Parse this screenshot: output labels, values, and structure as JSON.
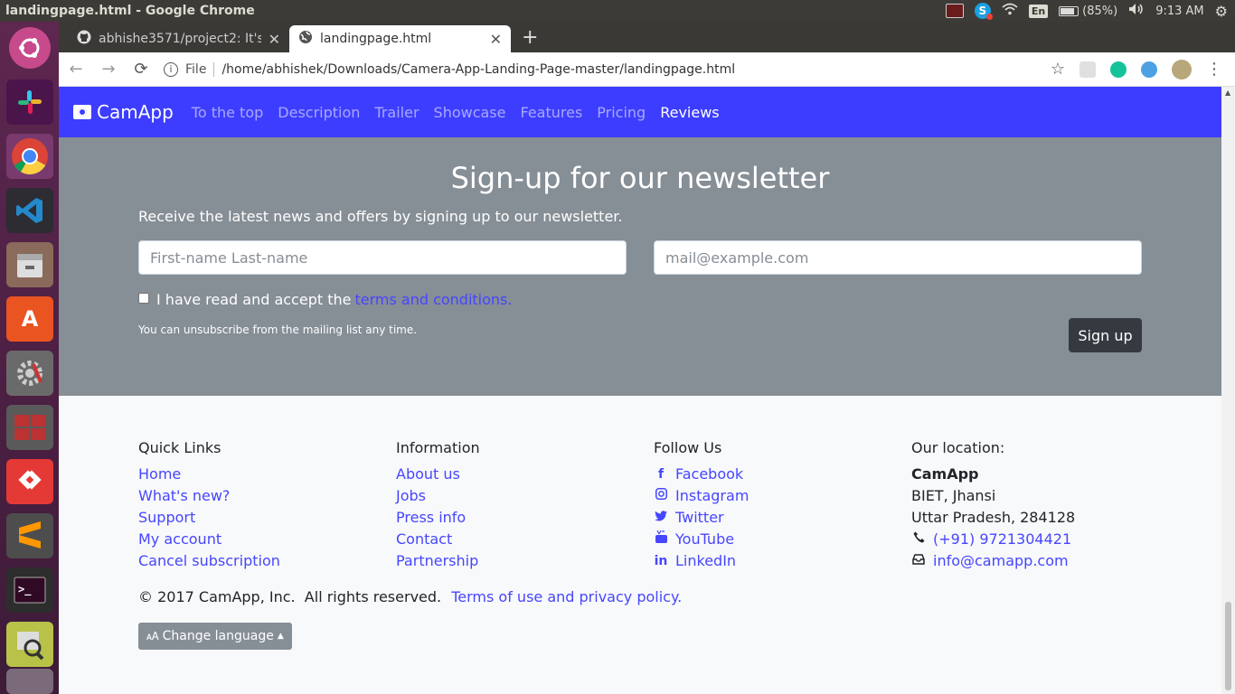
{
  "window": {
    "title": "landingpage.html - Google Chrome"
  },
  "tray": {
    "lang": "En",
    "battery": "(85%)",
    "time": "9:13 AM"
  },
  "tabs": [
    {
      "title": "abhishe3571/project2: It's"
    },
    {
      "title": "landingpage.html"
    }
  ],
  "omnibox": {
    "scheme_label": "File",
    "url": "/home/abhishek/Downloads/Camera-App-Landing-Page-master/landingpage.html"
  },
  "navbar": {
    "brand": "CamApp",
    "links": [
      "To the top",
      "Description",
      "Trailer",
      "Showcase",
      "Features",
      "Pricing",
      "Reviews"
    ],
    "active": "Reviews"
  },
  "newsletter": {
    "heading": "Sign-up for our newsletter",
    "lead": "Receive the latest news and offers by signing up to our newsletter.",
    "name_placeholder": "First-name Last-name",
    "email_placeholder": "mail@example.com",
    "checkbox_text": "I have read and accept the",
    "terms_link": "terms and conditions.",
    "note": "You can unsubscribe from the mailing list any time.",
    "button": "Sign up"
  },
  "footer": {
    "quick_links": {
      "title": "Quick Links",
      "items": [
        "Home",
        "What's new?",
        "Support",
        "My account",
        "Cancel subscription"
      ]
    },
    "information": {
      "title": "Information",
      "items": [
        "About us",
        "Jobs",
        "Press info",
        "Contact",
        "Partnership"
      ]
    },
    "follow": {
      "title": "Follow Us",
      "items": [
        "Facebook",
        "Instagram",
        "Twitter",
        "YouTube",
        "LinkedIn"
      ]
    },
    "location": {
      "title": "Our location:",
      "company": "CamApp",
      "line1": "BIET, Jhansi",
      "line2": "Uttar Pradesh, 284128",
      "phone": "(+91) 9721304421",
      "email": "info@camapp.com"
    },
    "copyright": "© 2017 CamApp, Inc.  All rights reserved.",
    "terms_link": "Terms of use and privacy policy.",
    "language_button": "Change language"
  },
  "colors": {
    "navbar": "#3d3dff",
    "newsletter_bg": "#868e96",
    "link": "#4646ff",
    "button_dark": "#343a40"
  }
}
